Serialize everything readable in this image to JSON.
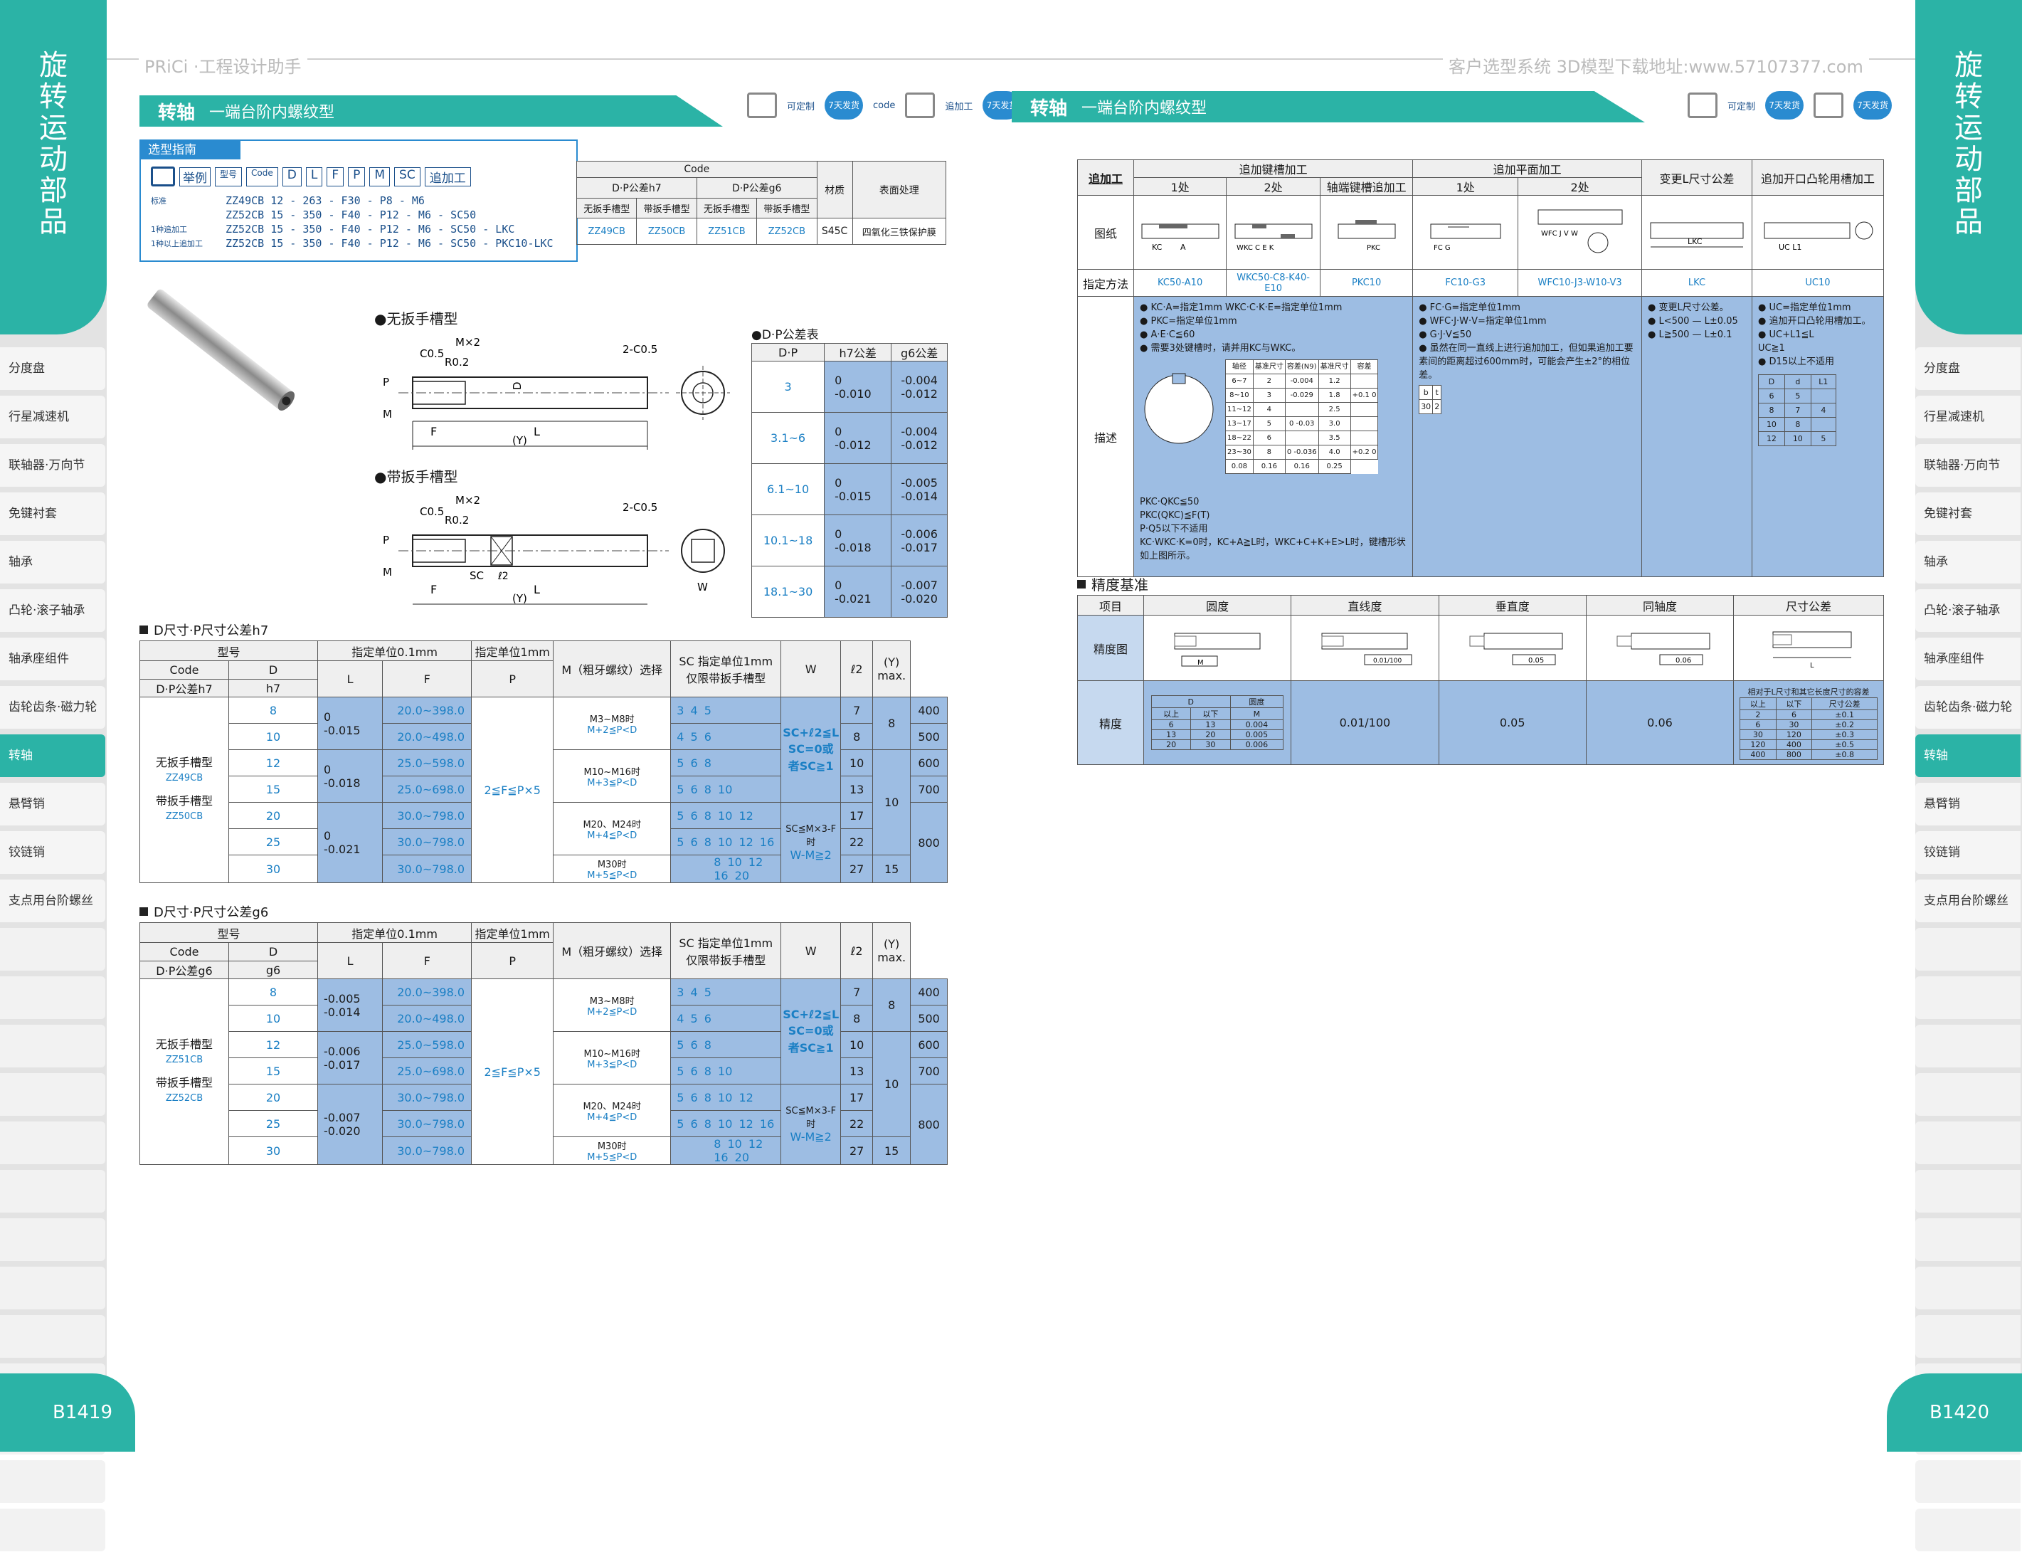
{
  "header": {
    "left_brand": "PRiCi ·工程设计助手",
    "right_site": "客户选型系统  3D模型下载地址:www.57107377.com"
  },
  "rail": {
    "title": "旋转运动部品",
    "items": [
      "分度盘",
      "行星减速机",
      "联轴器·万向节",
      "免键衬套",
      "轴承",
      "凸轮·滚子轴承",
      "轴承座组件",
      "齿轮齿条·磁力轮",
      "转轴",
      "悬臂销",
      "铰链销",
      "支点用台阶螺丝"
    ],
    "active": "转轴",
    "page_left": "B1419",
    "page_right": "B1420"
  },
  "left": {
    "title": "转轴",
    "subtitle": "一端台阶内螺纹型",
    "badges": {
      "custom": "可定制",
      "days1": "7天发货",
      "code": "code",
      "add": "追加工",
      "days2": "7天发货"
    },
    "guide": {
      "tab": "选型指南",
      "example": "举例",
      "header_cells": [
        "型号",
        "Code",
        "D",
        "L",
        "F",
        "P",
        "M",
        "SC",
        "追加工"
      ],
      "rows": [
        {
          "label": "标准",
          "text": "ZZ49CB 12 - 263 - F30 - P8 - M6"
        },
        {
          "label": "",
          "text": "ZZ52CB 15 - 350 - F40 - P12 - M6 - SC50"
        },
        {
          "label": "1种追加工",
          "text": "ZZ52CB 15 - 350 - F40 - P12 - M6 - SC50 - LKC"
        },
        {
          "label": "1种以上追加工",
          "text": "ZZ52CB 15 - 350 - F40 - P12 - M6 - SC50 - PKC10-LKC"
        }
      ]
    },
    "material_table": {
      "code": "Code",
      "h7": "D·P公差h7",
      "g6": "D·P公差g6",
      "material": "材质",
      "surface": "表面处理",
      "sub": [
        "无扳手槽型",
        "带扳手槽型",
        "无扳手槽型",
        "带扳手槽型"
      ],
      "codes": [
        "ZZ49CB",
        "ZZ50CB",
        "ZZ51CB",
        "ZZ52CB"
      ],
      "mat": "S45C",
      "surf": "四氧化三铁保护膜"
    },
    "drawing1_label": "●无扳手槽型",
    "drawing2_label": "●带扳手槽型",
    "dims": {
      "c05": "C0.5",
      "mx2": "M×2",
      "r02": "R0.2",
      "c05b": "2-C0.5",
      "P": "P",
      "M": "M",
      "F": "F",
      "L": "L",
      "Y": "(Y)",
      "D": "D",
      "SC": "SC",
      "l2": "ℓ2",
      "W": "W"
    },
    "tol_table": {
      "title": "●D·P公差表",
      "head": [
        "D·P",
        "h7公差",
        "g6公差"
      ],
      "rows": [
        [
          "3",
          "0",
          "-0.010",
          "-0.004",
          "-0.012"
        ],
        [
          "3.1~6",
          "0",
          "-0.012",
          "-0.004",
          "-0.012"
        ],
        [
          "6.1~10",
          "0",
          "-0.015",
          "-0.005",
          "-0.014"
        ],
        [
          "10.1~18",
          "0",
          "-0.018",
          "-0.006",
          "-0.017"
        ],
        [
          "18.1~30",
          "0",
          "-0.021",
          "-0.007",
          "-0.020"
        ]
      ]
    },
    "spec1": {
      "title": "D尺寸·P尺寸公差h7",
      "tol_label": "h7",
      "dp_label": "D·P公差h7",
      "type_a": "无扳手槽型",
      "code_a": "ZZ49CB",
      "type_b": "带扳手槽型",
      "code_b": "ZZ50CB",
      "tol_pairs": [
        [
          "0",
          "-0.015"
        ],
        [
          "0",
          "-0.018"
        ],
        [
          "0",
          "-0.021"
        ]
      ]
    },
    "spec2": {
      "title": "D尺寸·P尺寸公差g6",
      "tol_label": "g6",
      "dp_label": "D·P公差g6",
      "type_a": "无扳手槽型",
      "code_a": "ZZ51CB",
      "type_b": "带扳手槽型",
      "code_b": "ZZ52CB",
      "tol_pairs": [
        [
          "-0.005",
          "-0.014"
        ],
        [
          "-0.006",
          "-0.017"
        ],
        [
          "-0.007",
          "-0.020"
        ]
      ]
    },
    "spec_common": {
      "h_model": "型号",
      "h_code": "Code",
      "h_D": "D",
      "h_L_unit": "指定单位0.1mm",
      "h_P_unit": "指定单位1mm",
      "h_M": "M（粗牙螺纹）选择",
      "h_SC": "SC 指定单位1mm 仅限带扳手槽型",
      "h_W": "W",
      "h_l2": "ℓ2",
      "h_Y": "(Y) max.",
      "h_L": "L",
      "h_F": "F",
      "h_P": "P",
      "D": [
        "8",
        "10",
        "12",
        "15",
        "20",
        "25",
        "30"
      ],
      "L": [
        "20.0~398.0",
        "20.0~498.0",
        "25.0~598.0",
        "25.0~698.0",
        "30.0~798.0",
        "30.0~798.0",
        "30.0~798.0"
      ],
      "F": "2≦F≦P×5",
      "P_notes": [
        [
          "M3~M8时",
          "M+2≦P<D"
        ],
        [
          "M10~M16时",
          "M+3≦P<D"
        ],
        [
          "M20、M24时",
          "M+4≦P<D"
        ],
        [
          "M30时",
          "M+5≦P<D"
        ]
      ],
      "M": [
        "3 4 5",
        "4 5 6",
        "5 6 8",
        "5 6 8 10",
        "5 6 8 10 12",
        "5 6 8 10 12 16",
        "8 10 12 16 20"
      ],
      "SC1": [
        "SC+ℓ2≦L",
        "SC=0或者SC≧1"
      ],
      "SC2": [
        "SC≦M×3-F时",
        "W-M≧2"
      ],
      "W": [
        "7",
        "8",
        "10",
        "13",
        "17",
        "22",
        "27"
      ],
      "l2": [
        "8",
        "10",
        "15"
      ],
      "Y": [
        "400",
        "500",
        "600",
        "700",
        "800"
      ]
    }
  },
  "right": {
    "title": "转轴",
    "subtitle": "一端台阶内螺纹型",
    "addwork": {
      "corner": "追加工",
      "groups": [
        "追加键槽加工",
        "追加平面加工",
        "变更L尺寸公差",
        "追加开口凸轮用槽加工"
      ],
      "sub": [
        "1处",
        "2处",
        "轴端键槽追加工",
        "1处",
        "2处"
      ],
      "row_drawing": "图纸",
      "row_method": "指定方法",
      "row_desc": "描述",
      "methods": [
        "KC50-A10",
        "WKC50-C8-K40-E10",
        "PKC10",
        "FC10-G3",
        "WFC10-J3-W10-V3",
        "LKC",
        "UC10"
      ],
      "desc_key": [
        "● KC·A=指定1mm  WKC·C·K·E=指定单位1mm",
        "● PKC=指定单位1mm",
        "● A·E·C≦60",
        "● 需要3处键槽时，请并用KC与WKC。"
      ],
      "desc_key_bottom": [
        "PKC·QKC≦50",
        "PKC(QKC)≦F(T)",
        "P·Q5以下不适用",
        "KC·WKC·K=0时，KC+A≧L时，WKC+C+K+E>L时，键槽形状如上图所示。"
      ],
      "desc_flat": [
        "● FC·G=指定单位1mm",
        "● WFC·J·W·V=指定单位1mm",
        "● G·J·V≦50",
        "● 虽然在同一直线上进行追加加工，但如果追加工要素间的距离超过600mm时，可能会产生±2°的相位差。"
      ],
      "desc_L": [
        "● 变更L尺寸公差。",
        "● L<500 — L±0.05",
        "● L≧500 — L±0.1"
      ],
      "desc_uc": [
        "● UC=指定单位1mm",
        "● 追加开口凸轮用槽加工。",
        "● UC+L1≦L",
        "UC≧1",
        "● D15以上不适用"
      ],
      "uc_table_head": [
        "D",
        "d",
        "L1"
      ],
      "uc_table": [
        [
          "6",
          "5",
          ""
        ],
        [
          "8",
          "7",
          "4"
        ],
        [
          "10",
          "8",
          ""
        ],
        [
          "12",
          "10",
          "5"
        ]
      ],
      "key_table_head": [
        "轴径",
        "基准尺寸",
        "容差(N9)",
        "基准尺寸",
        "容差"
      ],
      "key_table": [
        [
          "6~7",
          "2",
          "-0.004",
          "1.2",
          ""
        ],
        [
          "8~10",
          "3",
          "-0.029",
          "1.8",
          "+0.1 0"
        ],
        [
          "11~12",
          "4",
          "",
          "2.5",
          ""
        ],
        [
          "13~17",
          "5",
          "0 -0.03",
          "3.0",
          ""
        ],
        [
          "18~22",
          "6",
          "",
          "3.5",
          ""
        ],
        [
          "23~30",
          "8",
          "0 -0.036",
          "4.0",
          "+0.2 0"
        ]
      ],
      "key_extra": [
        "0.08",
        "0.16",
        "0.16",
        "0.25"
      ],
      "flat_table": [
        [
          "b",
          "t"
        ],
        [
          "30",
          "2"
        ]
      ]
    },
    "precision": {
      "title": "精度基准",
      "heads": [
        "项目",
        "圆度",
        "直线度",
        "垂直度",
        "同轴度",
        "尺寸公差"
      ],
      "row1": "精度图",
      "row2": "精度",
      "round_table_head": [
        "D",
        "圆度"
      ],
      "round_sub": [
        "以上",
        "以下",
        "M"
      ],
      "round_rows": [
        [
          "6",
          "13",
          "0.004"
        ],
        [
          "13",
          "20",
          "0.005"
        ],
        [
          "20",
          "30",
          "0.006"
        ]
      ],
      "straight": "0.01/100",
      "perp": "0.05",
      "coax": "0.06",
      "dim_note": "相对于L尺寸和其它长度尺寸的容差",
      "dim_head": [
        "以上",
        "以下",
        "尺寸公差"
      ],
      "dim_rows": [
        [
          "2",
          "6",
          "±0.1"
        ],
        [
          "6",
          "30",
          "±0.2"
        ],
        [
          "30",
          "120",
          "±0.3"
        ],
        [
          "120",
          "400",
          "±0.5"
        ],
        [
          "400",
          "800",
          "±0.8"
        ]
      ],
      "drawing_marks": [
        "M",
        "0.01/100",
        "0.05",
        "0.06"
      ]
    }
  }
}
